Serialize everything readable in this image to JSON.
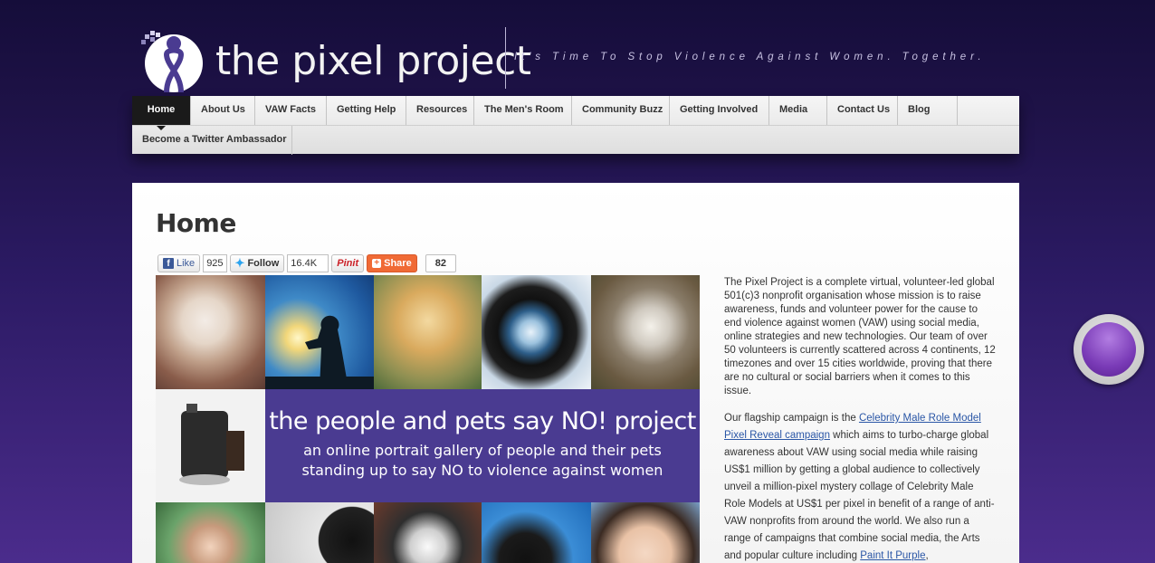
{
  "header": {
    "logo_text": "the pixel project",
    "tagline": "It's Time To Stop Violence Against Women. Together."
  },
  "nav": {
    "row1": [
      "Home",
      "About Us",
      "VAW Facts",
      "Getting Help",
      "Resources",
      "The Men's Room",
      "Community Buzz",
      "Getting Involved",
      "Media",
      "Contact Us",
      "Blog"
    ],
    "row2": [
      "Become a Twitter Ambassador"
    ],
    "active": "Home"
  },
  "page": {
    "title": "Home"
  },
  "social": {
    "like_label": "Like",
    "like_count": "925",
    "follow_label": "Follow",
    "follow_count": "16.4K fc",
    "pin_label": "Pinit",
    "share_label": "Share",
    "share_count": "82"
  },
  "banner": {
    "headline": "the people and pets say NO! project",
    "subline1": "an online portrait gallery of people and their pets",
    "subline2": "standing up to say NO to violence against women"
  },
  "description": {
    "p1": "The Pixel Project is a complete virtual, volunteer-led global 501(c)3 nonprofit organisation whose mission is to raise awareness, funds and volunteer power for the cause to end violence against women (VAW) using social media, online strategies and new technologies. Our team of over 50 volunteers is currently scattered across 4 continents, 12 timezones and over 15 cities worldwide, proving that there are no cultural or social barriers when it comes to this issue.",
    "p2_before": "Our flagship campaign is the ",
    "p2_link": "Celebrity Male Role Model Pixel Reveal campaign",
    "p2_middle": " which aims to turbo-charge global awareness about VAW using social media while raising US$1 million by getting a global audience to collectively unveil a million-pixel mystery collage of Celebrity Male Role Models at US$1 per pixel in benefit of a range of anti-VAW nonprofits from around the world. We also run a range of campaigns that combine social media, the Arts and popular culture including ",
    "p2_link2": "Paint It Purple",
    "p2_after": ","
  },
  "colors": {
    "background": "#1e1247",
    "banner": "#4a3b91",
    "nav_active": "#1a1a1a",
    "link": "#2a56a6"
  }
}
